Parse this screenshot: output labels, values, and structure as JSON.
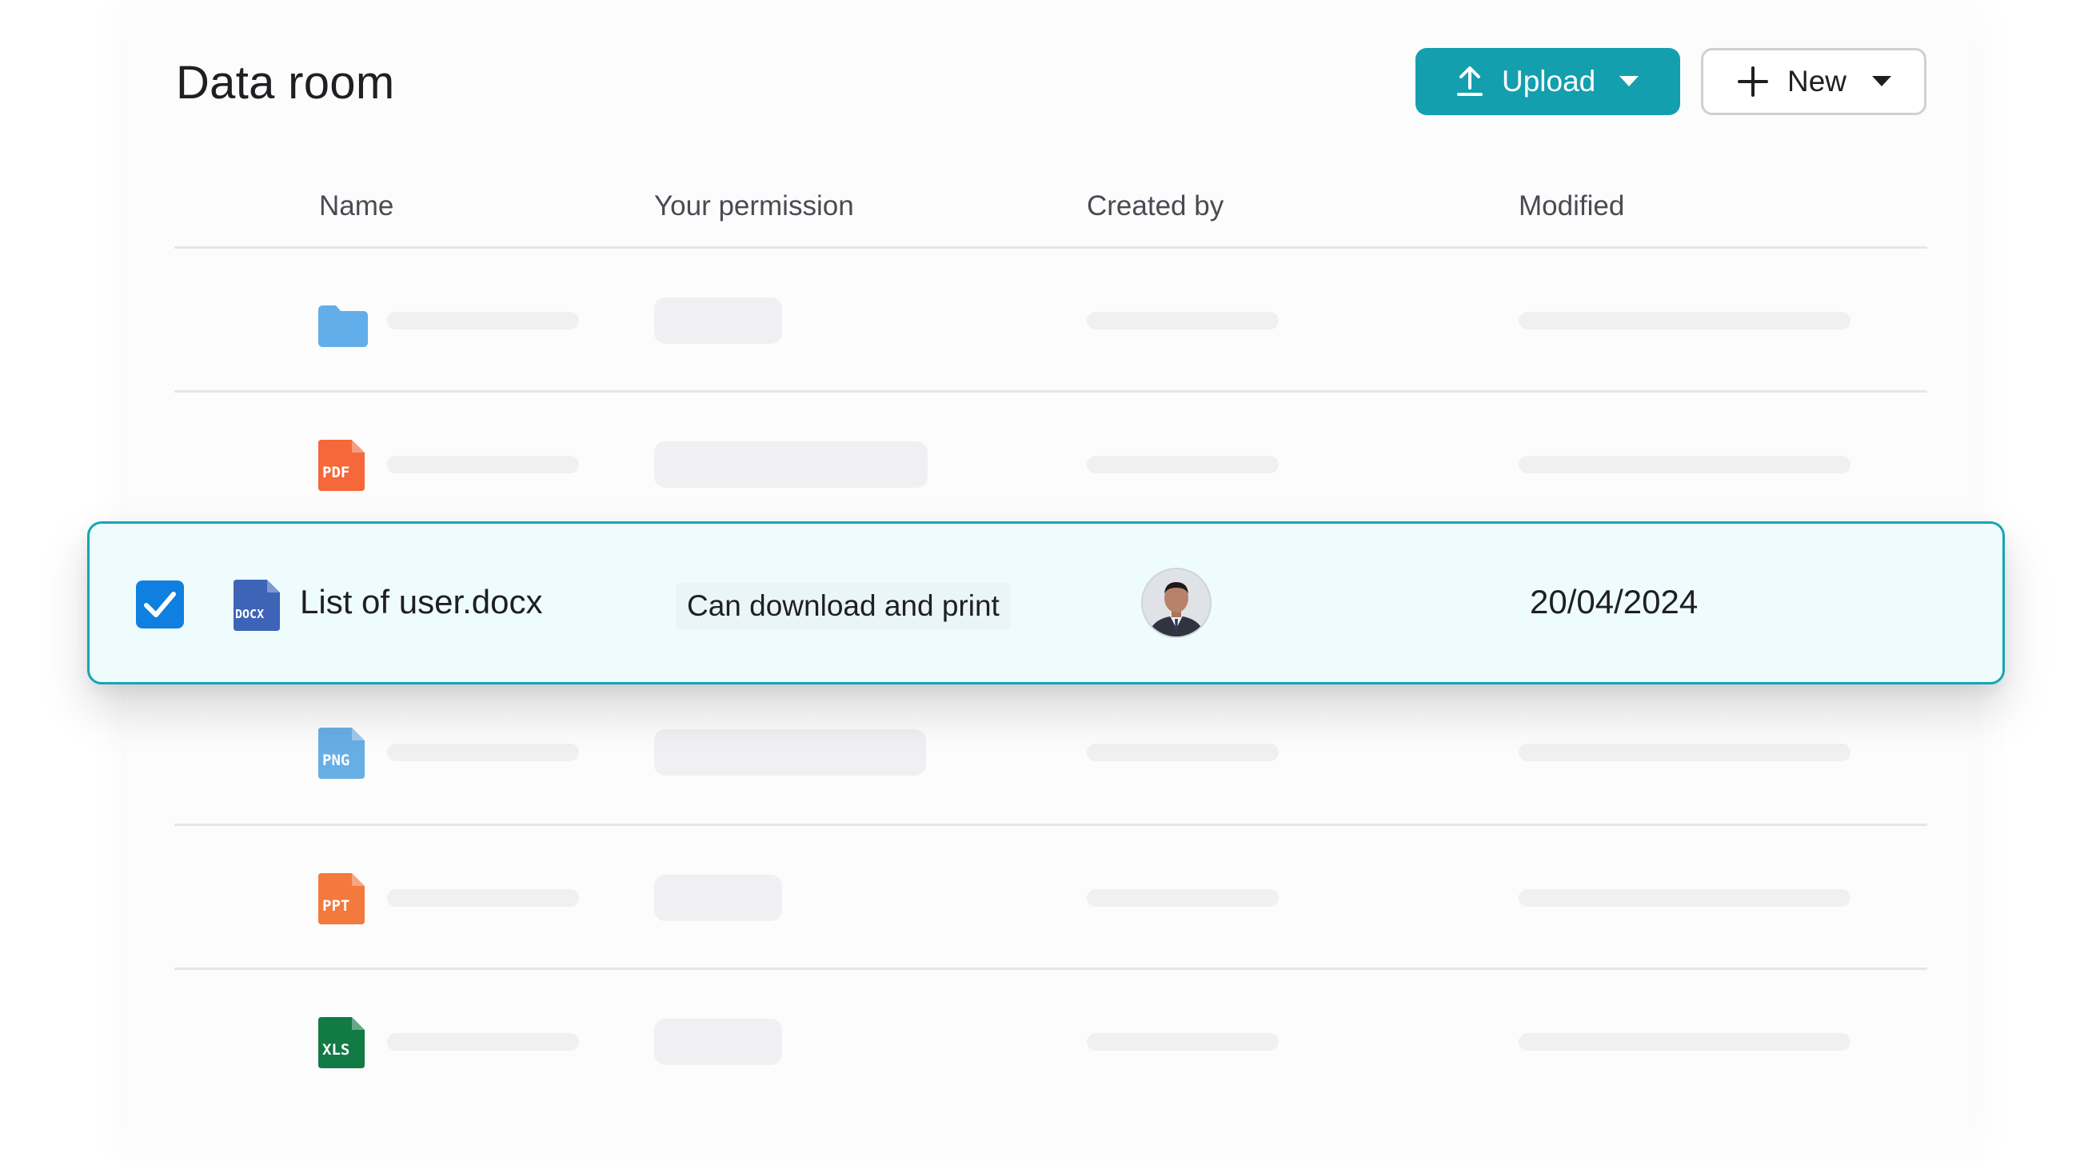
{
  "page": {
    "title": "Data room"
  },
  "toolbar": {
    "upload_label": "Upload",
    "new_label": "New"
  },
  "table": {
    "columns": [
      "Name",
      "Your permission",
      "Created by",
      "Modified"
    ],
    "rows": [
      {
        "type": "folder",
        "icon_color": "#62aeea"
      },
      {
        "type": "pdf",
        "icon_label": "PDF",
        "icon_color": "#f4683a"
      },
      {
        "type": "docx",
        "icon_label": "DOCX",
        "icon_color": "#3d64b6",
        "selected": true,
        "name": "List of user.docx",
        "permission": "Can download and print",
        "created_by_icon": "user-avatar-icon",
        "modified": "20/04/2024"
      },
      {
        "type": "png",
        "icon_label": "PNG",
        "icon_color": "#67aee4"
      },
      {
        "type": "ppt",
        "icon_label": "PPT",
        "icon_color": "#f3793d"
      },
      {
        "type": "xls",
        "icon_label": "XLS",
        "icon_color": "#127a45"
      }
    ]
  },
  "colors": {
    "accent": "#139fae",
    "selected_border": "#17a5b4",
    "selected_bg": "#effcfd",
    "checkbox": "#0f7fe0"
  }
}
